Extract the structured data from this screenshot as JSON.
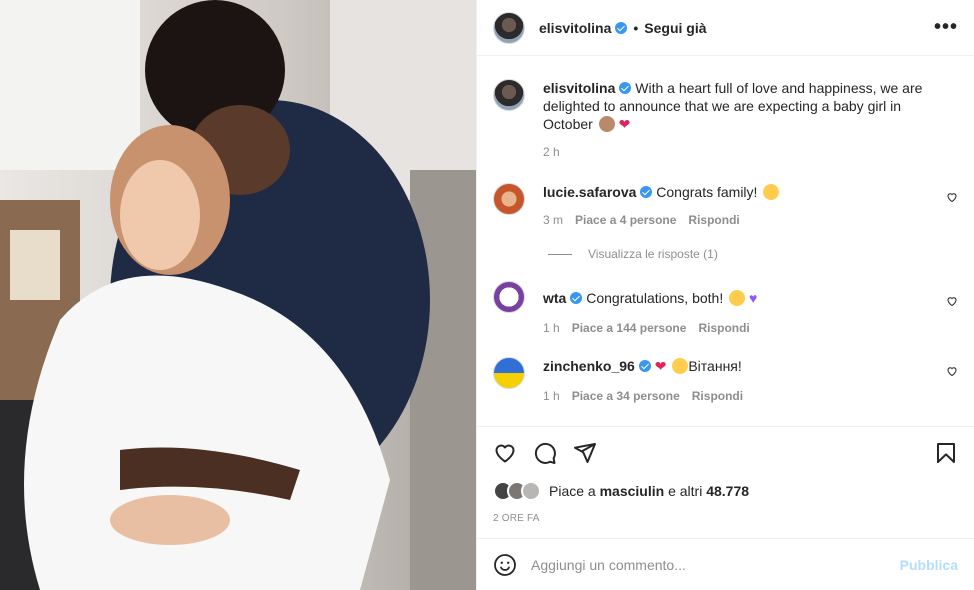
{
  "post": {
    "author": "elisvitolina",
    "follow_label": "Segui già",
    "more_label": "•••",
    "caption": "With a heart full of love and happiness, we are delighted to announce that we are expecting a baby girl in October",
    "caption_time": "2 h"
  },
  "comments": [
    {
      "user": "lucie.safarova",
      "text": "Congrats family!",
      "time": "3 m",
      "likes": "Piace a 4 persone",
      "reply": "Rispondi",
      "view_replies": "Visualizza le risposte (1)"
    },
    {
      "user": "wta",
      "text": "Congratulations, both!",
      "time": "1 h",
      "likes": "Piace a 144 persone",
      "reply": "Rispondi"
    },
    {
      "user": "zinchenko_96",
      "text": "Вітання!",
      "time": "1 h",
      "likes": "Piace a 34 persone",
      "reply": "Rispondi"
    }
  ],
  "likes": {
    "prefix": "Piace a",
    "user": "masciulin",
    "suffix": "e altri",
    "count": "48.778"
  },
  "time_ago": "2 ORE FA",
  "add_comment": {
    "placeholder": "Aggiungi un commento...",
    "publish_label": "Pubblica"
  },
  "icons": [
    "heart-icon",
    "comment-icon",
    "share-icon",
    "save-icon",
    "emoji-icon",
    "verified-icon"
  ],
  "colors": {
    "verified": "#3897f0",
    "publish": "#b2dffc",
    "muted": "#8e8e8e",
    "text": "#262626"
  }
}
